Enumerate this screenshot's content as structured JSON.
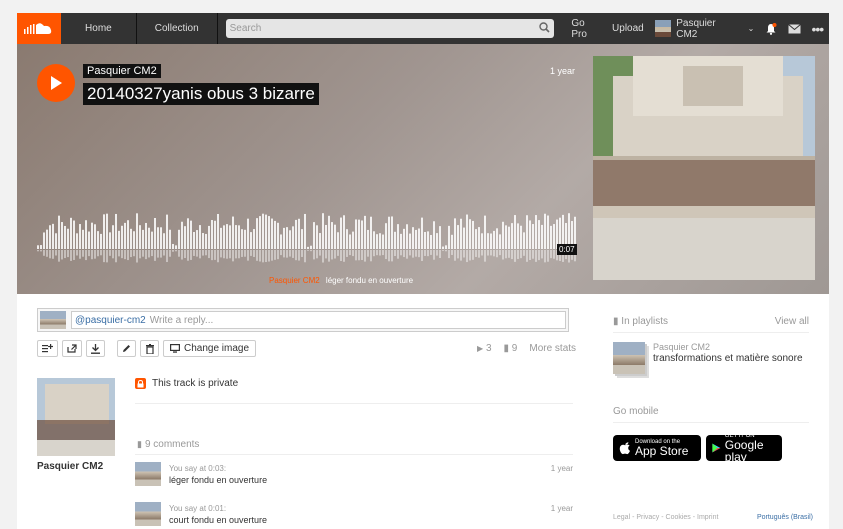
{
  "nav": {
    "items": [
      "Home",
      "Collection"
    ],
    "search_placeholder": "Search",
    "go_pro": "Go Pro",
    "upload": "Upload",
    "username": "Pasquier CM2"
  },
  "hero": {
    "artist": "Pasquier CM2",
    "title": "20140327yanis obus 3 bizarre",
    "date": "1 year",
    "duration": "0:07",
    "ticker_user": "Pasquier CM2",
    "ticker_text": "léger fondu en ouverture"
  },
  "reply": {
    "mention": "@pasquier-cm2",
    "placeholder": "Write a reply..."
  },
  "actions": {
    "change_image": "Change image",
    "plays": "3",
    "comments": "9",
    "more_stats": "More stats"
  },
  "track": {
    "uploader": "Pasquier CM2",
    "private_notice": "This track is private",
    "comments_count": "9 comments"
  },
  "comments": [
    {
      "user": "You",
      "say": "say at 0:03:",
      "text": "léger fondu en ouverture",
      "when": "1 year"
    },
    {
      "user": "You",
      "say": "say at 0:01:",
      "text": "court fondu en ouverture",
      "when": "1 year"
    }
  ],
  "sidebar": {
    "in_playlists": "In playlists",
    "view_all": "View all",
    "playlist_owner": "Pasquier CM2",
    "playlist_title": "transformations et matière sonore",
    "go_mobile": "Go mobile",
    "app_store_small": "Download on the",
    "app_store_big": "App Store",
    "google_small": "GET IT ON",
    "google_big": "Google play",
    "footer": "Legal - Privacy - Cookies - Imprint",
    "language": "Português (Brasil)"
  },
  "colors": {
    "accent": "#ff5500",
    "nav_bg": "#333333"
  }
}
